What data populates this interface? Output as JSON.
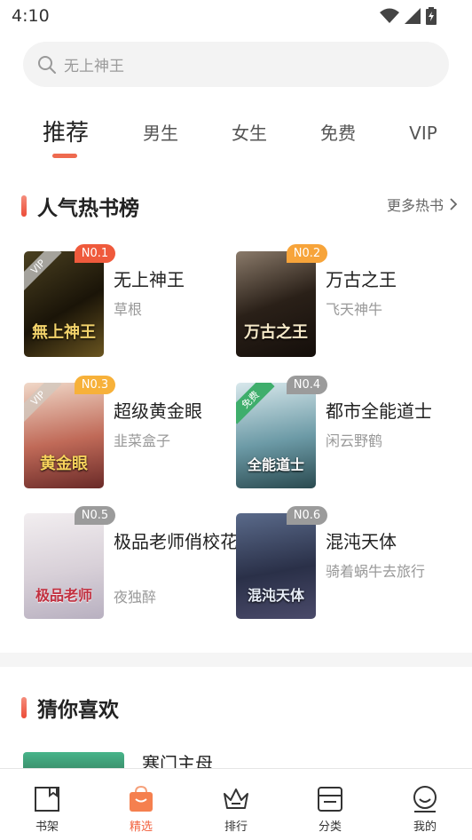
{
  "status_bar": {
    "time": "4:10"
  },
  "search": {
    "placeholder": "无上神王"
  },
  "tabs": [
    {
      "label": "推荐",
      "active": true
    },
    {
      "label": "男生"
    },
    {
      "label": "女生"
    },
    {
      "label": "免费"
    },
    {
      "label": "VIP"
    }
  ],
  "hot_section": {
    "title": "人气热书榜",
    "more_label": "更多热书"
  },
  "books": [
    {
      "rank": "N0.1",
      "title": "无上神王",
      "author": "草根",
      "cover_text": "無上神王",
      "ribbon": "VIP"
    },
    {
      "rank": "N0.2",
      "title": "万古之王",
      "author": "飞天神牛",
      "cover_text": "万古之王",
      "ribbon": ""
    },
    {
      "rank": "N0.3",
      "title": "超级黄金眼",
      "author": "韭菜盒子",
      "cover_text": "黄金眼",
      "ribbon": "VIP"
    },
    {
      "rank": "N0.4",
      "title": "都市全能道士",
      "author": "闲云野鹤",
      "cover_text": "全能道士",
      "ribbon": "免费"
    },
    {
      "rank": "N0.5",
      "title": "极品老师俏校花",
      "author": "夜独醉",
      "cover_text": "极品老师",
      "ribbon": ""
    },
    {
      "rank": "N0.6",
      "title": "混沌天体",
      "author": "骑着蜗牛去旅行",
      "cover_text": "混沌天体",
      "ribbon": ""
    }
  ],
  "guess_section": {
    "title": "猜你喜欢",
    "first_book_title": "寒门主母"
  },
  "bottom_nav": [
    {
      "label": "书架"
    },
    {
      "label": "精选",
      "active": true
    },
    {
      "label": "排行"
    },
    {
      "label": "分类"
    },
    {
      "label": "我的"
    }
  ],
  "colors": {
    "accent": "#f2623f",
    "badge_orange": "#f7b13a",
    "badge_red": "#ef5a3c",
    "badge_gray": "#9b9b9b"
  }
}
